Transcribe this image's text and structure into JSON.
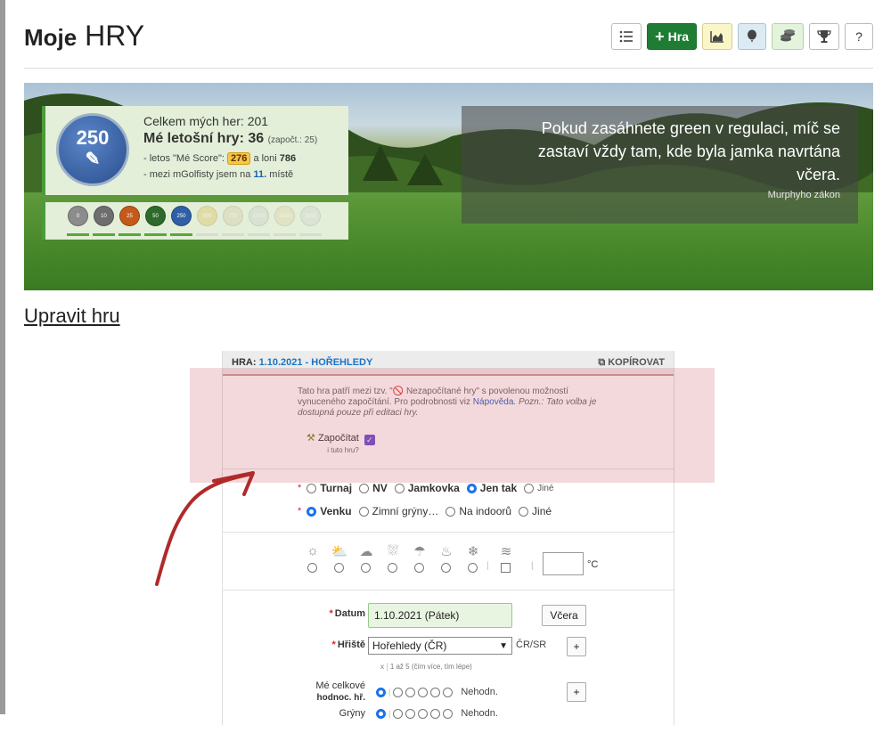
{
  "page": {
    "title_bold": "Moje",
    "title_rest": "HRY"
  },
  "toolbar": {
    "list_icon": "list-icon",
    "add_game_label": "Hra",
    "add_icon": "plus-icon",
    "chart_icon": "chart-icon",
    "balloon_icon": "balloon-icon",
    "coins_icon": "coins-icon",
    "trophy_icon": "trophy-icon",
    "help_label": "?"
  },
  "stats": {
    "badge_number": "250",
    "total_label": "Celkem mých her: 201",
    "year_label": "Mé letošní hry: 36",
    "year_counted": "(započt.: 25)",
    "score_prefix": "- letos \"Mé Score\":",
    "score_value": "276",
    "score_suffix": "a loni",
    "score_last_year": "786",
    "rank_prefix": "- mezi mGolfisty jsem na",
    "rank_value": "11.",
    "rank_suffix": "místě"
  },
  "medals": [
    {
      "label": "0",
      "color": "#8c8c8c"
    },
    {
      "label": "10",
      "color": "#6e6e6e"
    },
    {
      "label": "25",
      "color": "#c45a1a"
    },
    {
      "label": "50",
      "color": "#2e6a2a"
    },
    {
      "label": "250",
      "color": "#2f5fa6"
    },
    {
      "label": "500",
      "color": "#e0b84a"
    },
    {
      "label": "750",
      "color": "#d5c4a0"
    },
    {
      "label": "1000",
      "color": "#c9c9c9"
    },
    {
      "label": "1500",
      "color": "#e0d0a0"
    },
    {
      "label": "2000",
      "color": "#cfcfcf"
    }
  ],
  "quote": {
    "text": "Pokud zasáhnete green v regulaci, míč se zastaví vždy tam, kde byla jamka navrtána včera.",
    "author": "Murphyho zákon"
  },
  "section": {
    "edit_link": "Upravit hru"
  },
  "form": {
    "header_prefix": "HRA:",
    "header_game": "1.10.2021 - HOŘEHLEDY",
    "copy_label": "KOPÍROVAT",
    "info_text_1": "Tato hra patří mezi tzv. \"🚫 Nezapočítané hry\" s povolenou možností vynuceného započítání. Pro podrobnosti viz",
    "info_help_link": "Nápověda",
    "info_text_2": ". Pozn.: Tato volba je dostupná pouze při editaci hry.",
    "count_label": "Započítat",
    "count_sublabel": "i tuto hru?",
    "game_types": [
      {
        "label": "Turnaj",
        "selected": false
      },
      {
        "label": "NV",
        "selected": false
      },
      {
        "label": "Jamkovka",
        "selected": false
      },
      {
        "label": "Jen tak",
        "selected": true
      },
      {
        "label": "Jiné",
        "selected": false
      }
    ],
    "locations": [
      {
        "label": "Venku",
        "selected": true
      },
      {
        "label": "Zimní grýny…",
        "selected": false
      },
      {
        "label": "Na indoorů",
        "selected": false
      },
      {
        "label": "Jiné",
        "selected": false
      }
    ],
    "weather_icons": [
      "sun-icon",
      "partly-cloudy-icon",
      "cloud-icon",
      "rain-sun-icon",
      "rain-icon",
      "fire-icon",
      "snowflake-icon",
      "wind-icon"
    ],
    "temp_unit": "°C",
    "date_label": "Datum",
    "date_value": "1.10.2021 (Pátek)",
    "yesterday_label": "Včera",
    "course_label": "Hřiště",
    "course_value": "Hořehledy (ČR)",
    "course_suffix": "ČR/SR",
    "plus_label": "+",
    "rating_hint_prefix": "x",
    "rating_hint": "1 až 5 (čím více, tím lépe)",
    "overall_label_1": "Mé celkové",
    "overall_label_2": "hodnoc. hř.",
    "greens_label": "Grýny",
    "undecided_label": "Nehodn."
  }
}
